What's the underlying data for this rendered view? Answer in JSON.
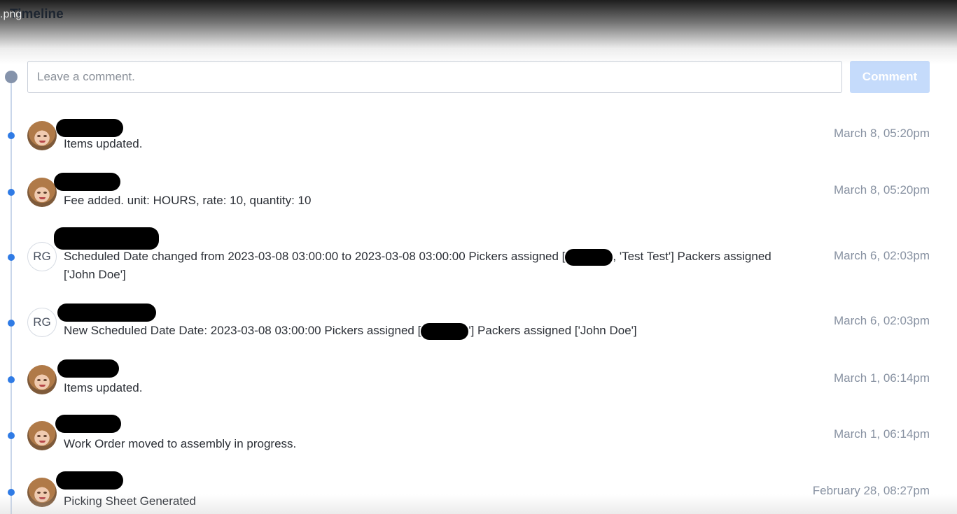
{
  "viewer": {
    "file_label": ".png"
  },
  "section": {
    "title": "Timeline"
  },
  "comment_box": {
    "placeholder": "Leave a comment.",
    "button_label": "Comment"
  },
  "entries": [
    {
      "avatar": "photo",
      "message": "Items updated.",
      "timestamp": "March 8, 05:20pm"
    },
    {
      "avatar": "photo",
      "message": "Fee added. unit: HOURS, rate: 10, quantity: 10",
      "timestamp": "March 8, 05:20pm"
    },
    {
      "avatar": "initials",
      "initials": "RG",
      "message_part_1": "Scheduled Date changed from 2023-03-08 03:00:00 to 2023-03-08 03:00:00 Pickers assigned [",
      "message_part_2": ", 'Test Test'] Packers assigned ['John Doe']",
      "timestamp": "March 6, 02:03pm"
    },
    {
      "avatar": "initials",
      "initials": "RG",
      "message_part_1": "New Scheduled Date Date: 2023-03-08 03:00:00 Pickers assigned [",
      "message_part_2": "'] Packers assigned ['John Doe']",
      "timestamp": "March 6, 02:03pm"
    },
    {
      "avatar": "photo",
      "message": "Items updated.",
      "timestamp": "March 1, 06:14pm"
    },
    {
      "avatar": "photo",
      "message": "Work Order moved to assembly in progress.",
      "timestamp": "March 1, 06:14pm"
    },
    {
      "avatar": "photo",
      "message": "Picking Sheet Generated",
      "timestamp": "February 28, 08:27pm"
    }
  ]
}
